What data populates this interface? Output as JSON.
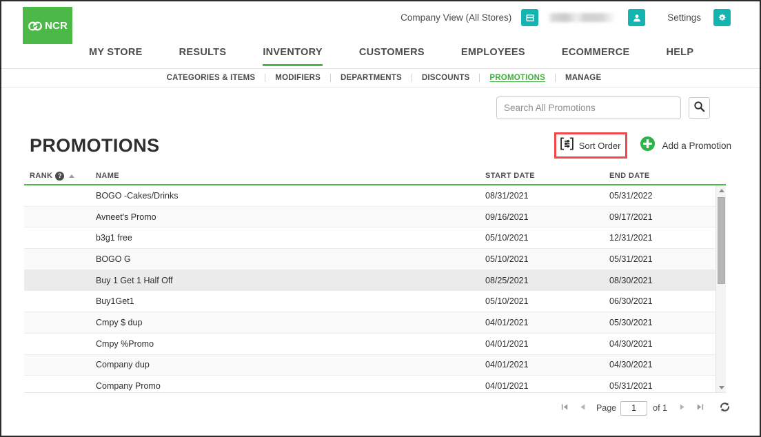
{
  "colors": {
    "brand_green": "#4cb847",
    "teal": "#14b5b0",
    "highlight_red": "#f0484a",
    "text_dark": "#2f2f2f"
  },
  "header": {
    "logo_text": "NCR",
    "company_view_label": "Company View (All Stores)",
    "store_icon": "store-icon",
    "user_name_redacted": "",
    "user_icon": "user-icon",
    "settings_label": "Settings",
    "gear_icon": "gear-icon"
  },
  "main_nav": {
    "items": [
      {
        "label": "MY STORE",
        "active": false
      },
      {
        "label": "RESULTS",
        "active": false
      },
      {
        "label": "INVENTORY",
        "active": true
      },
      {
        "label": "CUSTOMERS",
        "active": false
      },
      {
        "label": "EMPLOYEES",
        "active": false
      },
      {
        "label": "ECOMMERCE",
        "active": false
      },
      {
        "label": "HELP",
        "active": false
      }
    ]
  },
  "sub_nav": {
    "items": [
      {
        "label": "CATEGORIES & ITEMS",
        "active": false
      },
      {
        "label": "MODIFIERS",
        "active": false
      },
      {
        "label": "DEPARTMENTS",
        "active": false
      },
      {
        "label": "DISCOUNTS",
        "active": false
      },
      {
        "label": "PROMOTIONS",
        "active": true
      },
      {
        "label": "MANAGE",
        "active": false
      }
    ]
  },
  "search": {
    "placeholder": "Search All Promotions",
    "value": "",
    "icon": "search-icon"
  },
  "title": "PROMOTIONS",
  "toolbar": {
    "sort_order_label": "Sort Order",
    "sort_order_icon": "sort-order-icon",
    "add_promotion_label": "Add a Promotion",
    "add_promotion_icon": "plus-circle-icon"
  },
  "table": {
    "columns": [
      {
        "key": "rank",
        "label": "RANK",
        "help": "?",
        "sorted": "asc"
      },
      {
        "key": "name",
        "label": "NAME",
        "sorted": "none"
      },
      {
        "key": "start",
        "label": "START DATE",
        "sorted": "none"
      },
      {
        "key": "end",
        "label": "END DATE",
        "sorted": "none"
      }
    ],
    "rows": [
      {
        "rank": "",
        "name": "BOGO -Cakes/Drinks",
        "start": "08/31/2021",
        "end": "05/31/2022",
        "highlighted": false
      },
      {
        "rank": "",
        "name": "Avneet's Promo",
        "start": "09/16/2021",
        "end": "09/17/2021",
        "highlighted": false
      },
      {
        "rank": "",
        "name": "b3g1 free",
        "start": "05/10/2021",
        "end": "12/31/2021",
        "highlighted": false
      },
      {
        "rank": "",
        "name": "BOGO G",
        "start": "05/10/2021",
        "end": "05/31/2021",
        "highlighted": false
      },
      {
        "rank": "",
        "name": "Buy 1 Get 1 Half Off",
        "start": "08/25/2021",
        "end": "08/30/2021",
        "highlighted": true
      },
      {
        "rank": "",
        "name": "Buy1Get1",
        "start": "05/10/2021",
        "end": "06/30/2021",
        "highlighted": false
      },
      {
        "rank": "",
        "name": "Cmpy $ dup",
        "start": "04/01/2021",
        "end": "05/30/2021",
        "highlighted": false
      },
      {
        "rank": "",
        "name": "Cmpy %Promo",
        "start": "04/01/2021",
        "end": "04/30/2021",
        "highlighted": false
      },
      {
        "rank": "",
        "name": "Company dup",
        "start": "04/01/2021",
        "end": "04/30/2021",
        "highlighted": false
      },
      {
        "rank": "",
        "name": "Company Promo",
        "start": "04/01/2021",
        "end": "05/31/2021",
        "highlighted": false
      }
    ]
  },
  "pager": {
    "first_icon": "first-page-icon",
    "prev_icon": "previous-page-icon",
    "page_label": "Page",
    "page_value": "1",
    "of_label": "of 1",
    "next_icon": "next-page-icon",
    "last_icon": "last-page-icon",
    "refresh_icon": "refresh-icon"
  }
}
